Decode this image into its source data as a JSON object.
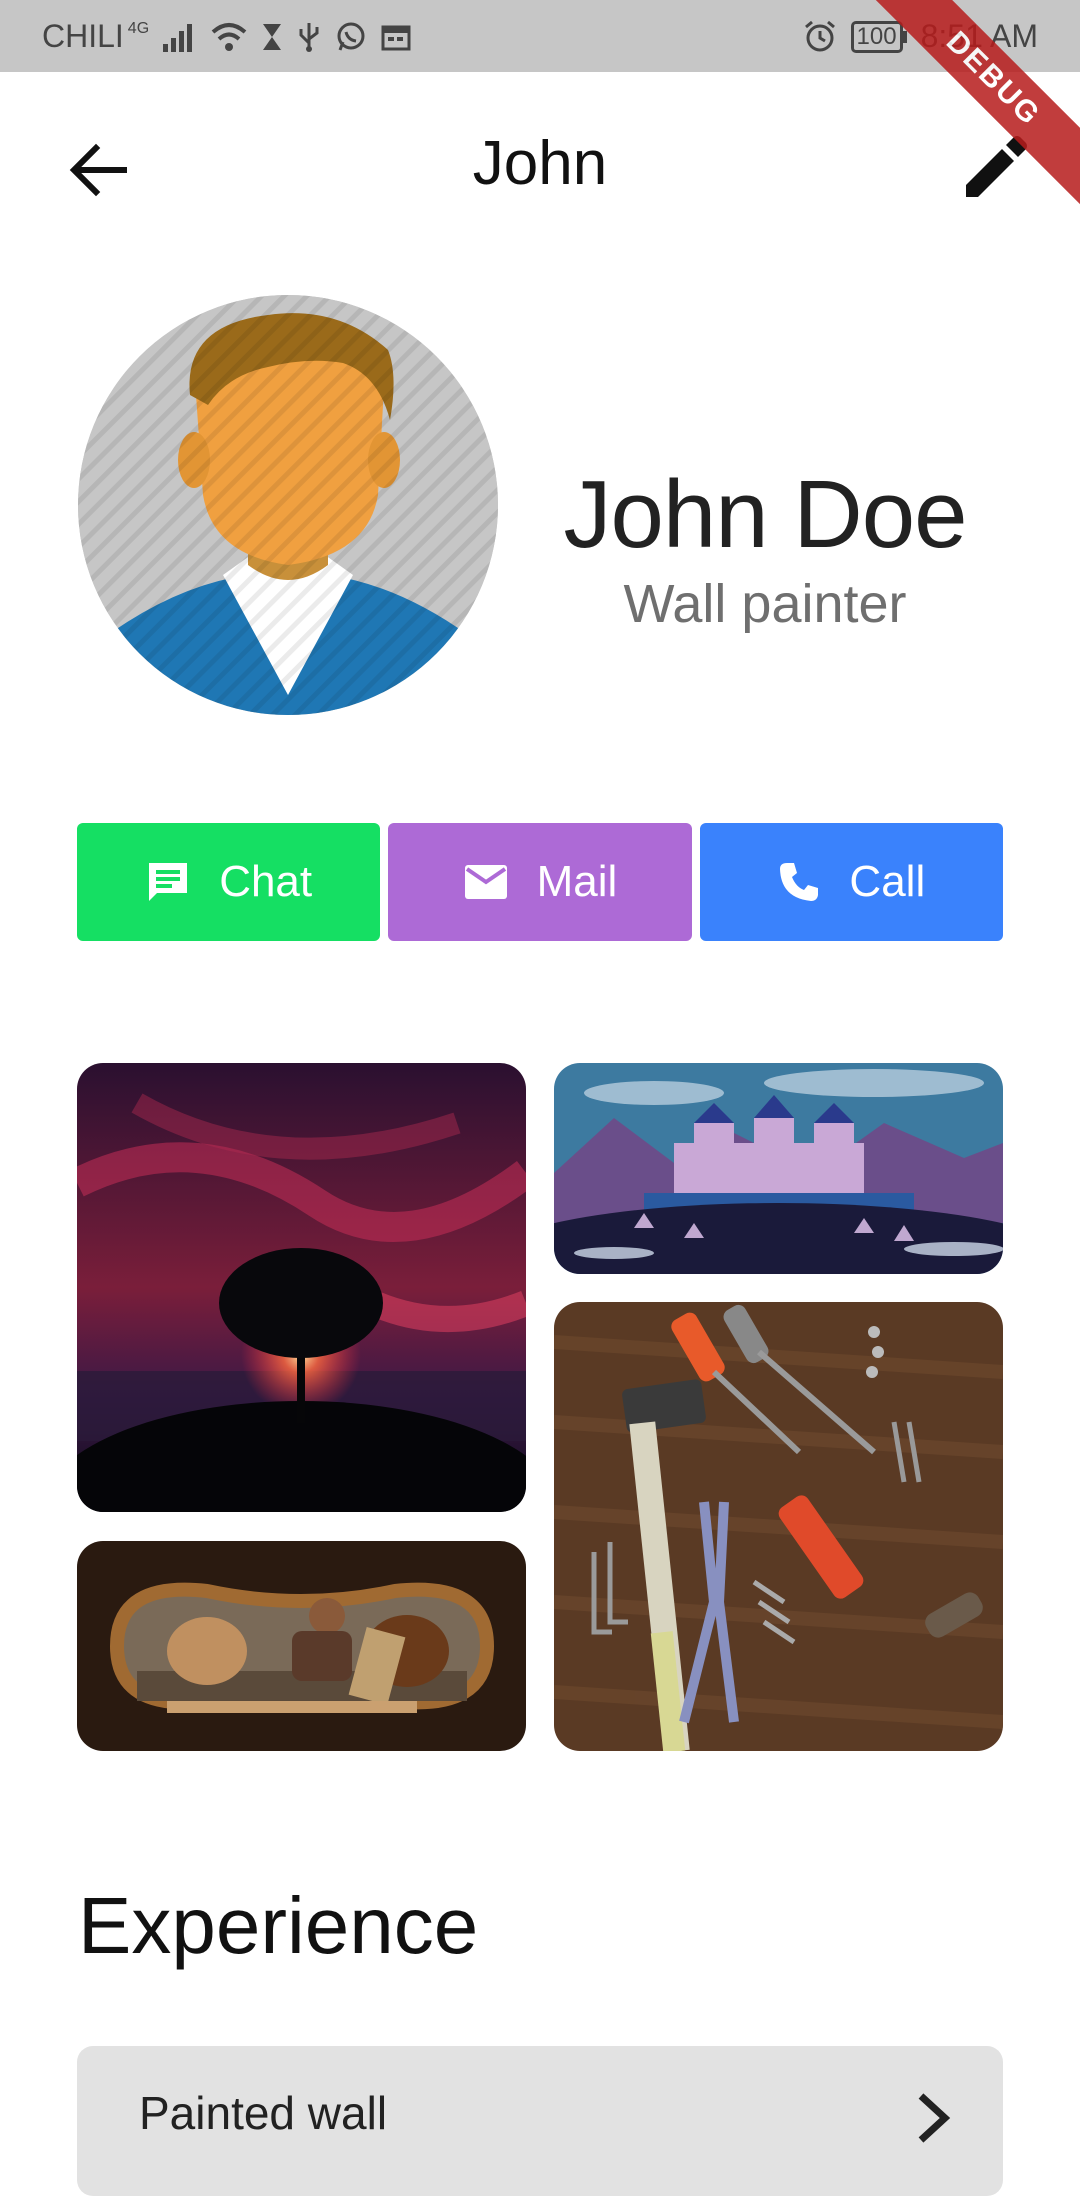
{
  "status_bar": {
    "carrier": "CHILI",
    "network": "4G",
    "battery": "100",
    "time": "8:51 AM",
    "debug_banner": "DEBUG"
  },
  "app_bar": {
    "title": "John",
    "back_icon": "arrow-left-icon",
    "edit_icon": "pencil-icon"
  },
  "profile": {
    "name": "John Doe",
    "role": "Wall painter"
  },
  "actions": [
    {
      "label": "Chat",
      "icon": "chat-icon",
      "color": "#15df63"
    },
    {
      "label": "Mail",
      "icon": "mail-icon",
      "color": "#ad6ad6"
    },
    {
      "label": "Call",
      "icon": "phone-icon",
      "color": "#3a82fc"
    }
  ],
  "experience": {
    "title": "Experience",
    "items": [
      {
        "label": "Painted wall"
      }
    ]
  }
}
